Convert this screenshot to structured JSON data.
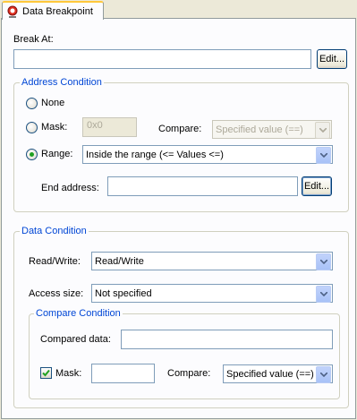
{
  "tab": {
    "label": "Data Breakpoint",
    "icon": "breakpoint-icon"
  },
  "break_at": {
    "label": "Break At:",
    "value": "",
    "edit_label": "Edit..."
  },
  "address_condition": {
    "title": "Address Condition",
    "none_label": "None",
    "mask_label": "Mask:",
    "mask_value": "0x0",
    "compare_label": "Compare:",
    "compare_value": "Specified value (==)",
    "range_label": "Range:",
    "range_value": "Inside the range (<= Values <=)",
    "end_address_label": "End address:",
    "end_address_value": "",
    "edit_label": "Edit...",
    "selected": "range"
  },
  "data_condition": {
    "title": "Data Condition",
    "readwrite_label": "Read/Write:",
    "readwrite_value": "Read/Write",
    "access_size_label": "Access size:",
    "access_size_value": "Not specified",
    "compare_condition": {
      "title": "Compare Condition",
      "compared_data_label": "Compared data:",
      "compared_data_value": "",
      "mask_label": "Mask:",
      "mask_checked": true,
      "mask_value": "",
      "compare_label": "Compare:",
      "compare_value": "Specified value (==)"
    }
  },
  "colors": {
    "group_title": "#0046d5",
    "radio_dot": "#21a121",
    "check_mark": "#21a121",
    "tab_accent": "#ffc83c"
  }
}
